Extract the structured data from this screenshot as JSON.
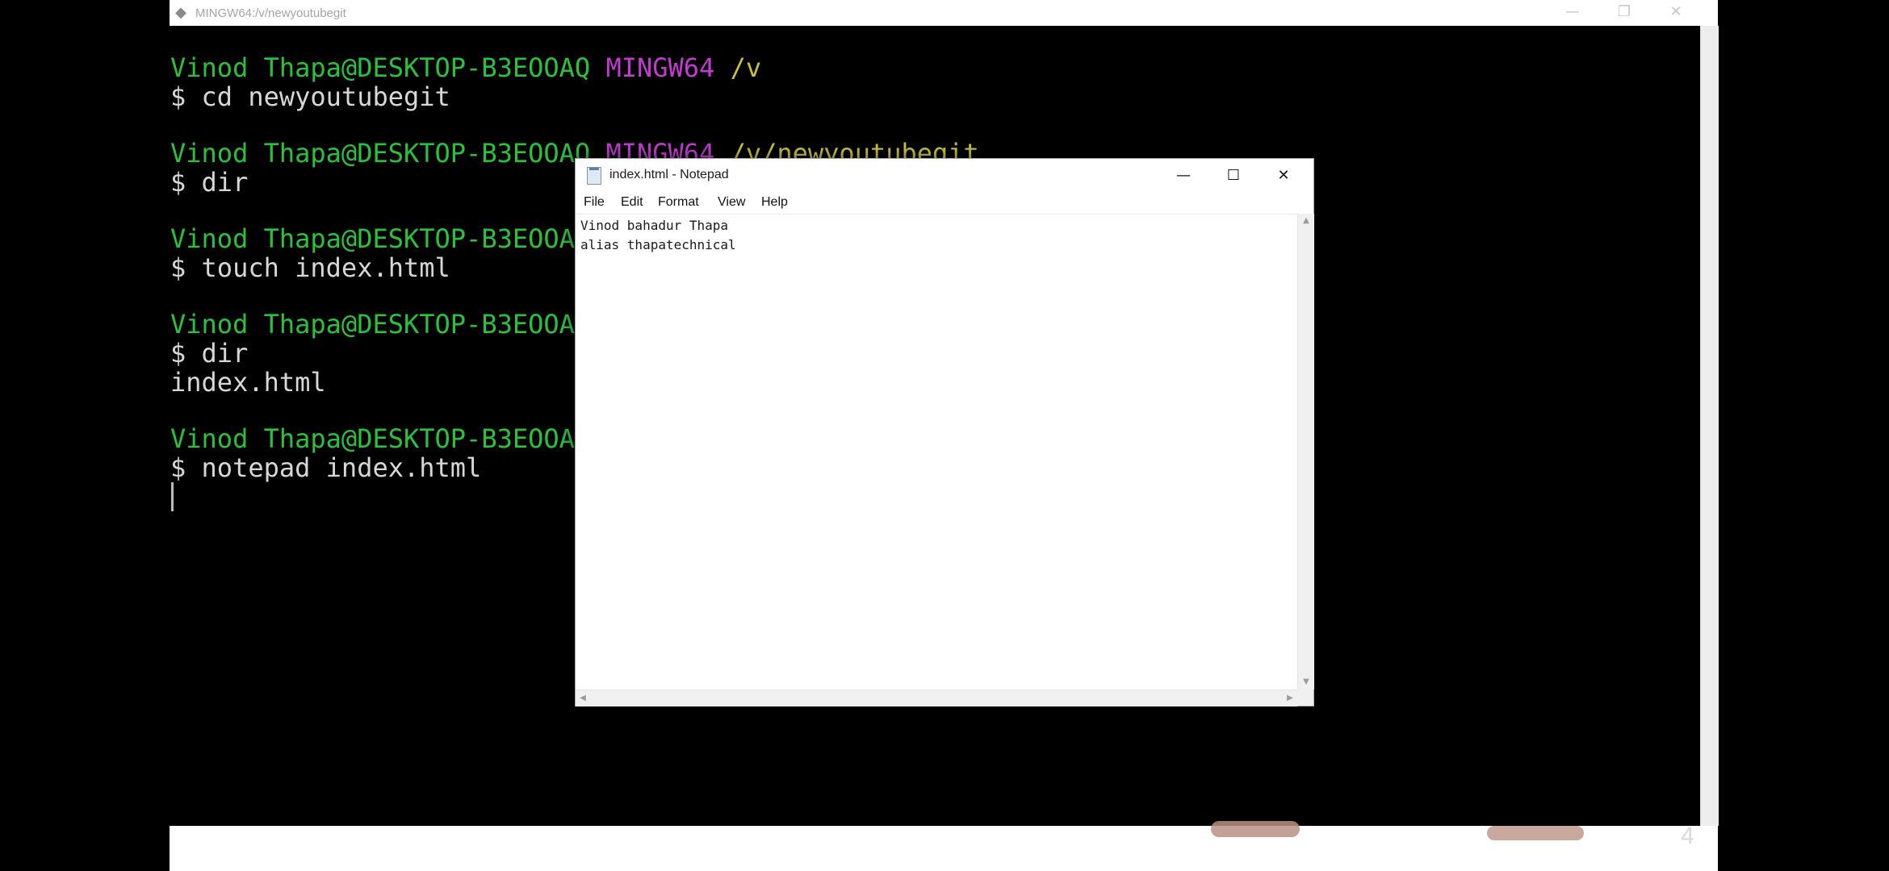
{
  "bash": {
    "title": "MINGW64:/v/newyoutubegit",
    "icon": "git-bash-icon",
    "controls": {
      "minimize": "—",
      "restore": "❐",
      "close": "✕"
    },
    "prompt": {
      "user_host": "Vinod Thapa@DESKTOP-B3EOOAQ",
      "user_host_partial": "Vinod Thapa@DESKTOP-B3EOOA",
      "system": "MINGW64",
      "path_root": "/v",
      "path_repo": "/v/newyoutubegit"
    },
    "commands": [
      "$ cd newyoutubegit",
      "$ dir",
      "$ touch index.html",
      "$ dir",
      "$ notepad index.html"
    ],
    "output": [
      "index.html"
    ]
  },
  "notepad": {
    "title": "index.html - Notepad",
    "controls": {
      "minimize": "—",
      "maximize": "☐",
      "close": "✕"
    },
    "menu": [
      "File",
      "Edit",
      "Format",
      "View",
      "Help"
    ],
    "content": [
      "Vinod bahadur Thapa",
      "alias thapatechnical"
    ]
  },
  "page_number": "4",
  "colors": {
    "prompt_user": "#29c23b",
    "prompt_system": "#c43ad3",
    "prompt_path": "#c9c13b",
    "text": "#d7d7d7"
  }
}
